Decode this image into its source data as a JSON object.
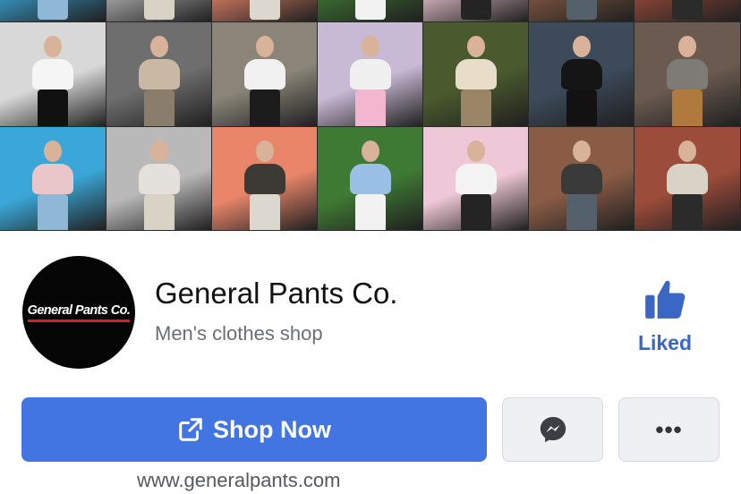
{
  "page": {
    "name": "General Pants Co.",
    "category": "Men's clothes shop",
    "logo_text": "General Pants Co.",
    "website": "www.generalpants.com"
  },
  "like": {
    "label": "Liked",
    "icon": "thumbs-up-icon",
    "color": "#3b67c4"
  },
  "actions": {
    "primary_label": "Shop Now",
    "primary_icon": "external-link-icon",
    "primary_color": "#4274e2",
    "messenger_icon": "messenger-icon",
    "more_label": "•••"
  },
  "cover": {
    "description_tiles": [
      {
        "bg": "#3aa7d8",
        "shirt": "#e8c6c9",
        "pants": "#8fb7d6"
      },
      {
        "bg": "#b9b9b9",
        "shirt": "#e4e1dc",
        "pants": "#d9d3c6"
      },
      {
        "bg": "#e9866a",
        "shirt": "#3d3a35",
        "pants": "#dcd8cf"
      },
      {
        "bg": "#3f7a34",
        "shirt": "#9bc0e6",
        "pants": "#f2f2f2"
      },
      {
        "bg": "#eec8d6",
        "shirt": "#f3f3f3",
        "pants": "#242424"
      },
      {
        "bg": "#8a5c46",
        "shirt": "#3a3a3a",
        "pants": "#55606d"
      },
      {
        "bg": "#9c4c3a",
        "shirt": "#d9d2c6",
        "pants": "#2b2b2b"
      },
      {
        "bg": "#d8d8d8",
        "shirt": "#f5f5f5",
        "pants": "#111111"
      },
      {
        "bg": "#6e6e6e",
        "shirt": "#c9b8a3",
        "pants": "#8a7d6c"
      },
      {
        "bg": "#8a8578",
        "shirt": "#f1f1f1",
        "pants": "#1c1c1c"
      },
      {
        "bg": "#c8b9d4",
        "shirt": "#f0f0f0",
        "pants": "#f2b7cf"
      },
      {
        "bg": "#4b5a2e",
        "shirt": "#e7ddc9",
        "pants": "#9a8566"
      },
      {
        "bg": "#3c4a5a",
        "shirt": "#151515",
        "pants": "#121212"
      },
      {
        "bg": "#6a5a4f",
        "shirt": "#7e7b76",
        "pants": "#b07a3e"
      }
    ]
  }
}
